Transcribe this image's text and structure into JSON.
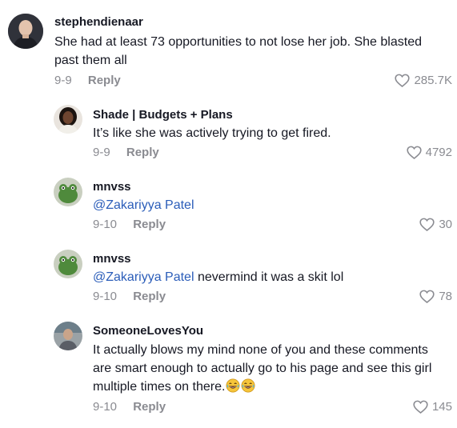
{
  "comments": [
    {
      "username": "stephendienaar",
      "text_lines": [
        "She had at least 73 opportunities to not lose her job. She blasted",
        "past them all"
      ],
      "date": "9-9",
      "reply_label": "Reply",
      "likes": "285.7K",
      "avatar_icon": "bald-man-avatar"
    },
    {
      "username": "Shade | Budgets + Plans",
      "text_lines": [
        "It’s like she was actively trying to get fired."
      ],
      "date": "9-9",
      "reply_label": "Reply",
      "likes": "4792",
      "avatar_icon": "woman-avatar"
    },
    {
      "username": "mnvss",
      "mention": "@Zakariyya Patel",
      "text_after": "",
      "date": "9-10",
      "reply_label": "Reply",
      "likes": "30",
      "avatar_icon": "frog-avatar"
    },
    {
      "username": "mnvss",
      "mention": "@Zakariyya Patel",
      "text_after": " nevermind it was a skit lol",
      "date": "9-10",
      "reply_label": "Reply",
      "likes": "78",
      "avatar_icon": "frog-avatar"
    },
    {
      "username": "SomeoneLovesYou",
      "text_lines": [
        "It actually blows my mind none of you and these comments",
        "are smart enough to actually go to his page and see this girl",
        "multiple times on there."
      ],
      "emoji_names": [
        "laughing-face-emoji",
        "laughing-face-emoji"
      ],
      "date": "9-10",
      "reply_label": "Reply",
      "likes": "145",
      "avatar_icon": "person-avatar"
    }
  ],
  "colors": {
    "text": "#161823",
    "meta": "#8a8b91",
    "mention": "#2b5db9"
  }
}
